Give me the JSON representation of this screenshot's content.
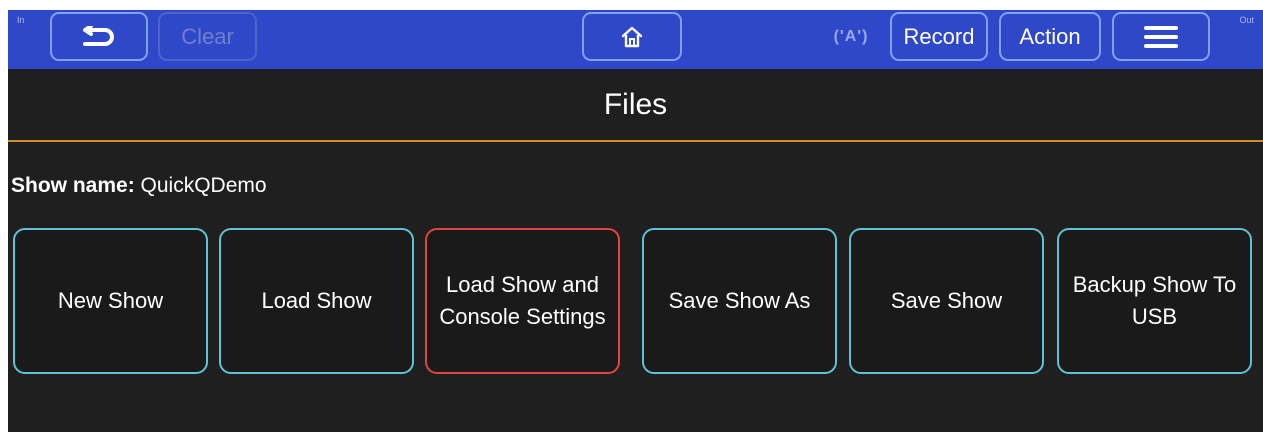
{
  "topbar": {
    "in_label": "In",
    "out_label": "Out",
    "undo_icon": "undo-arrow-icon",
    "clear_label": "Clear",
    "home_icon": "home-icon",
    "antenna_label": "('A')",
    "record_label": "Record",
    "action_label": "Action",
    "menu_icon": "hamburger-menu-icon",
    "bar_color": "#2f48c9",
    "button_border_color": "#7fa2ff"
  },
  "page": {
    "title": "Files",
    "accent_color": "#d48a2a"
  },
  "show": {
    "label": "Show name:",
    "name": "QuickQDemo"
  },
  "file_buttons": [
    {
      "label": "New Show",
      "selected": false
    },
    {
      "label": "Load Show",
      "selected": false
    },
    {
      "label": "Load Show and Console Settings",
      "selected": true
    },
    {
      "label": "Save Show As",
      "selected": false
    },
    {
      "label": "Save Show",
      "selected": false
    },
    {
      "label": "Backup Show To USB",
      "selected": false
    }
  ],
  "colors": {
    "button_border": "#5ec3d8",
    "selected_border": "#e0463f",
    "background": "#1f1f1f"
  }
}
